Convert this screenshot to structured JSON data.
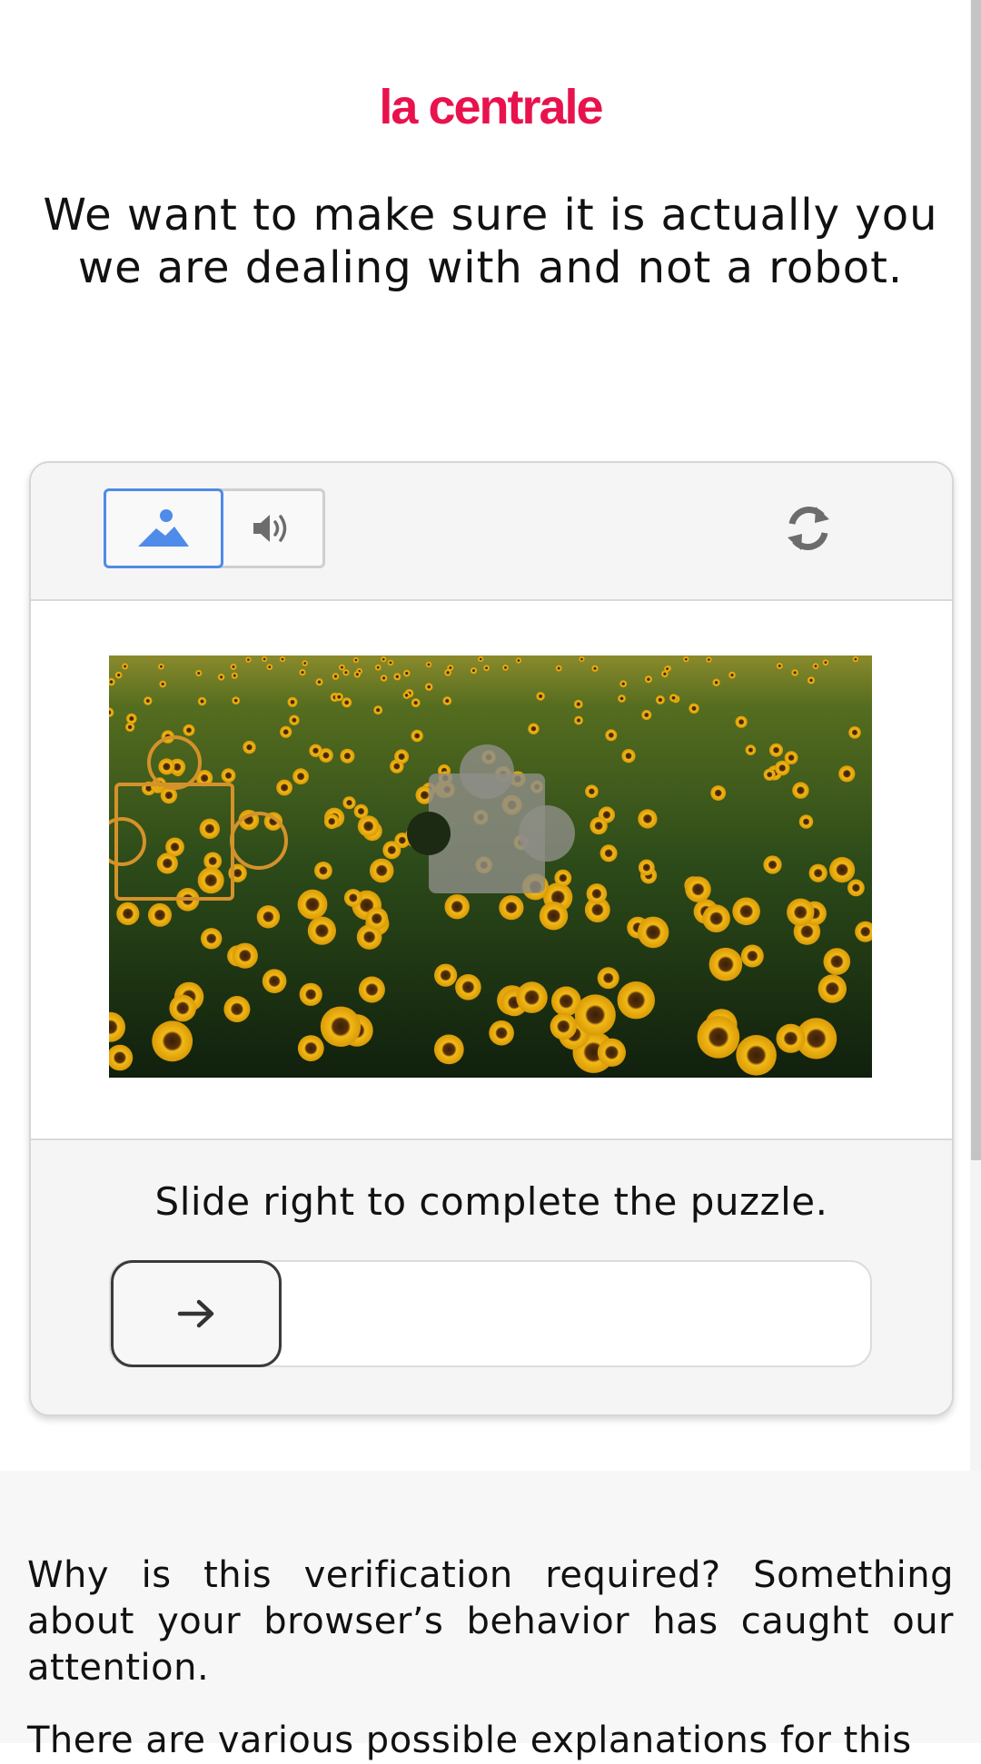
{
  "brand": {
    "logo_text": "la centrale",
    "color": "#e8124d"
  },
  "headline": "We want to make sure it is actually you we are dealing with and not a robot.",
  "captcha": {
    "modes": [
      {
        "icon": "image-mode-icon",
        "selected": true
      },
      {
        "icon": "speaker-icon",
        "selected": false
      }
    ],
    "refresh_icon": "refresh-icon",
    "puzzle_image": "sunflower-field-photo",
    "instruction": "Slide right to complete the puzzle.",
    "slider_icon": "arrow-right-icon",
    "slider_progress": 0,
    "accent_color": "#4f8be8",
    "piece_outline_color": "#d4922a"
  },
  "info": {
    "text": "Why is this verification required? Something about your browser’s behavior has caught our attention.",
    "next_text": "There are various possible explanations for this"
  }
}
